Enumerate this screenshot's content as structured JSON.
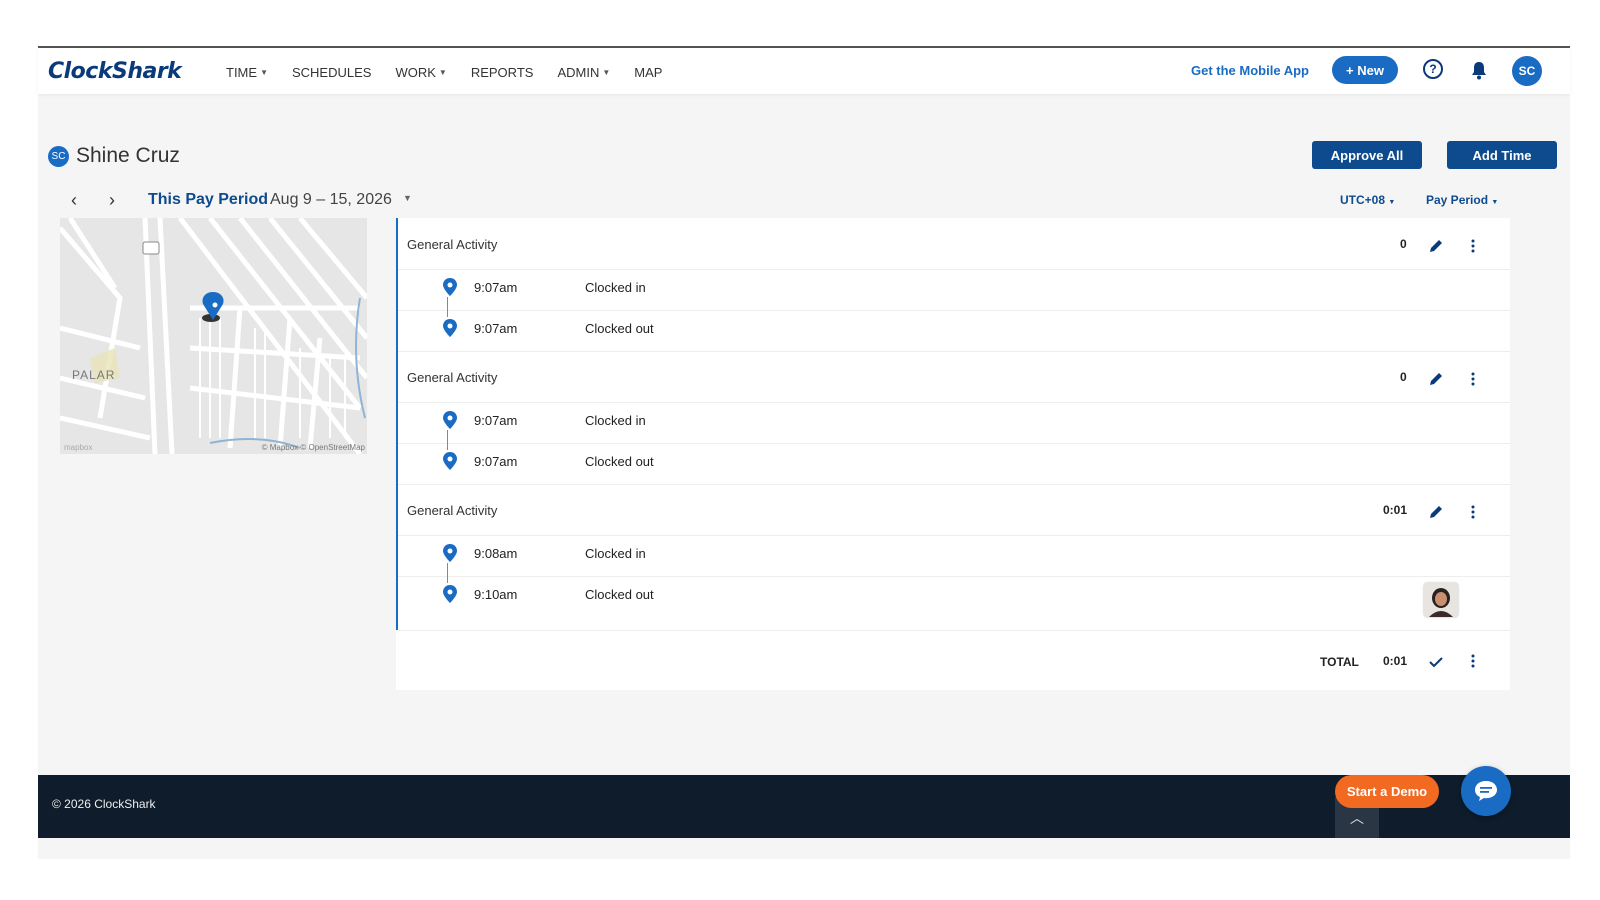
{
  "nav": {
    "logo": "ClockShark",
    "menu": [
      {
        "label": "TIME",
        "has_dropdown": true
      },
      {
        "label": "SCHEDULES",
        "has_dropdown": false
      },
      {
        "label": "WORK",
        "has_dropdown": true
      },
      {
        "label": "REPORTS",
        "has_dropdown": false
      },
      {
        "label": "ADMIN",
        "has_dropdown": true
      },
      {
        "label": "MAP",
        "has_dropdown": false
      }
    ],
    "mobile_app_link": "Get the Mobile App",
    "new_button": "+ New",
    "help_icon": "question-circle-icon",
    "bell_icon": "bell-icon",
    "user_initials": "SC"
  },
  "header": {
    "user_initials": "SC",
    "user_name": "Shine Cruz",
    "approve_all": "Approve All",
    "add_time": "Add Time"
  },
  "period": {
    "label": "This Pay Period",
    "range": "Aug 9 – 15, 2026",
    "timezone": "UTC+08",
    "view": "Pay Period"
  },
  "map": {
    "place_label": "PALAR",
    "attribution": "© Mapbox © OpenStreetMap",
    "logo": "mapbox"
  },
  "entries": [
    {
      "activity": "General Activity",
      "duration": "0",
      "events": [
        {
          "time": "9:07am",
          "label": "Clocked in"
        },
        {
          "time": "9:07am",
          "label": "Clocked out"
        }
      ]
    },
    {
      "activity": "General Activity",
      "duration": "0",
      "events": [
        {
          "time": "9:07am",
          "label": "Clocked in"
        },
        {
          "time": "9:07am",
          "label": "Clocked out"
        }
      ]
    },
    {
      "activity": "General Activity",
      "duration": "0:01",
      "events": [
        {
          "time": "9:08am",
          "label": "Clocked in"
        },
        {
          "time": "9:10am",
          "label": "Clocked out"
        }
      ]
    }
  ],
  "total": {
    "label": "TOTAL",
    "value": "0:01"
  },
  "footer": {
    "copyright": "© 2026 ClockShark",
    "demo_button": "Start a Demo"
  },
  "colors": {
    "primary": "#1a6bc4",
    "dark_blue": "#0e4b8e",
    "footer_bg": "#0e1c2c",
    "demo_orange": "#f26a22"
  }
}
